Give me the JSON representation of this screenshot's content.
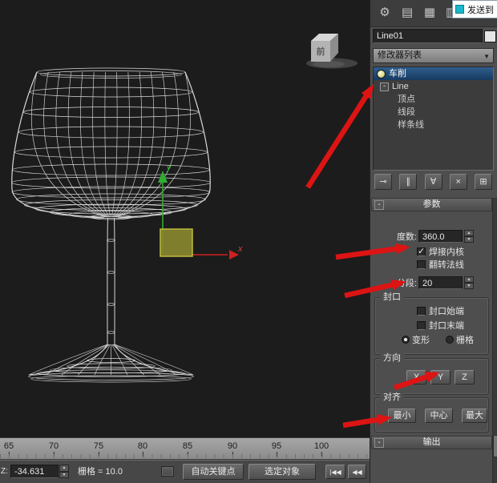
{
  "toolbar": {
    "send_to": "发送到"
  },
  "panel": {
    "object_name": "Line01",
    "modifier_list": "修改器列表",
    "stack": [
      {
        "label": "车削",
        "selected": true
      },
      {
        "label": "Line"
      },
      {
        "label": "顶点"
      },
      {
        "label": "线段"
      },
      {
        "label": "样条线"
      }
    ],
    "rollouts": {
      "parameters": "参数",
      "output": "输出"
    },
    "params": {
      "degrees_label": "度数:",
      "degrees_value": "360.0",
      "weld_core": "焊接内核",
      "weld_core_checked": true,
      "flip_normals": "翻转法线",
      "flip_normals_checked": false,
      "segments_label": "分段:",
      "segments_value": "20"
    },
    "capping": {
      "title": "封口",
      "cap_start": "封口始端",
      "cap_start_checked": false,
      "cap_end": "封口末端",
      "cap_end_checked": false,
      "morph": "变形",
      "grid": "栅格",
      "selected": "morph"
    },
    "direction": {
      "title": "方向",
      "x": "X",
      "y": "Y",
      "z": "Z"
    },
    "align": {
      "title": "对齐",
      "min": "最小",
      "center": "中心",
      "max": "最大"
    }
  },
  "icons": {
    "minus": "-",
    "dropdown": "▼",
    "up": "▲",
    "down": "▼",
    "gear": "⚙",
    "panel_a": "▤",
    "panel_b": "▦",
    "panel_c": "▥",
    "pin": "⊸",
    "show_end": "∥",
    "unique": "∀",
    "remove": "×",
    "configure": "⊞",
    "go_start": "|◀◀",
    "back": "◀◀"
  },
  "viewport": {
    "viewcube": "前",
    "axis_x": "x",
    "axis_y": "y"
  },
  "timeline": {
    "ticks": [
      "65",
      "70",
      "75",
      "80",
      "85",
      "90",
      "95",
      "100"
    ]
  },
  "status": {
    "z_label": "Z:",
    "z_value": "-34.631",
    "grid": "栅格 = 10.0",
    "auto_key": "自动关键点",
    "selection": "选定对象"
  }
}
